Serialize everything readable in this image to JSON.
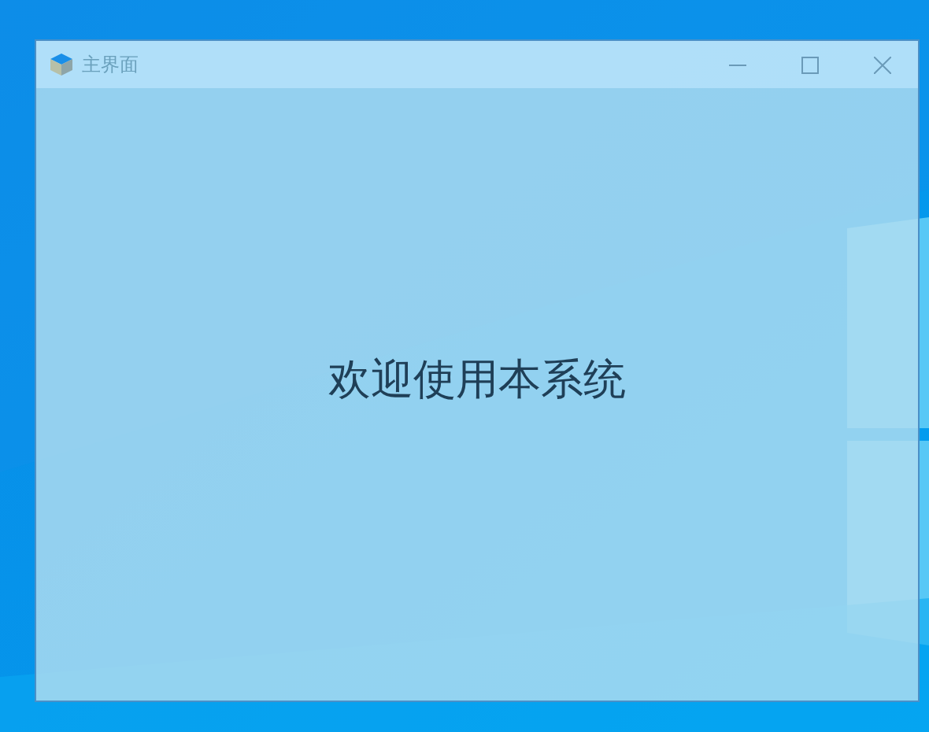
{
  "window": {
    "title": "主界面",
    "buttons": [
      {
        "kind": "minimize"
      },
      {
        "kind": "maximize"
      },
      {
        "kind": "close"
      }
    ]
  },
  "content": {
    "welcome": "欢迎使用本系统"
  }
}
